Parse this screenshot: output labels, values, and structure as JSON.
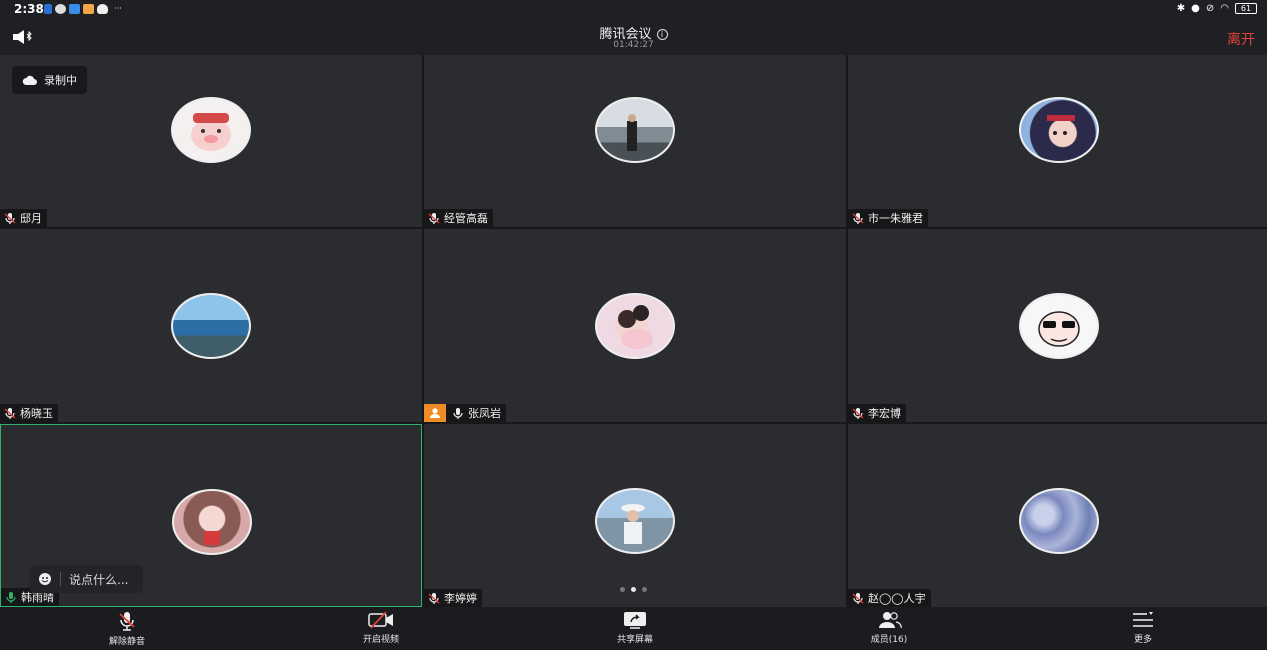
{
  "status_bar": {
    "time": "2:38",
    "battery": "61"
  },
  "header": {
    "title": "腾讯会议",
    "elapsed": "01:42:27",
    "leave_label": "离开"
  },
  "recording": {
    "label": "录制中"
  },
  "participants": [
    {
      "name": "邸月"
    },
    {
      "name": "经管高磊"
    },
    {
      "name": "市一朱雅君"
    },
    {
      "name": "杨晓玉"
    },
    {
      "name": "张凤岩",
      "host": true
    },
    {
      "name": "李宏博"
    },
    {
      "name": "韩雨晴"
    },
    {
      "name": "李婷婷"
    },
    {
      "name": "赵◯◯人宇"
    }
  ],
  "chat": {
    "placeholder": "说点什么..."
  },
  "pager": {
    "count": 3,
    "current": 2
  },
  "toolbar": {
    "unmute_label": "解除静音",
    "video_label": "开启视频",
    "share_label": "共享屏幕",
    "members_label": "成员(16)",
    "more_label": "更多"
  },
  "colors": {
    "leave": "#e0413a",
    "host_badge": "#f08c28",
    "active_border": "#2fb36b"
  }
}
